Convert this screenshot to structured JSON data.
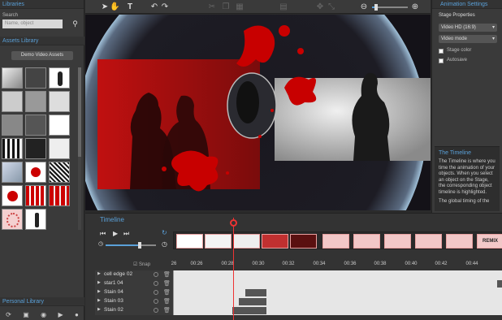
{
  "left_panel": {
    "libraries_title": "Libraries",
    "search_label": "Search",
    "search_placeholder": "Name, object",
    "asset_library_title": "Assets Library",
    "library_selected": "Demo Video Assets",
    "personal_library_title": "Personal Library"
  },
  "right_panel": {
    "title": "Animation Settings",
    "stage_properties": "Stage Properties",
    "video_format": "Video HD (16:9)",
    "video_mode": "Video mode",
    "stage_color_label": "Stage color",
    "autosave_label": "Autosave",
    "help_title": "The Timeline",
    "help_text_1": "The Timeline is where you time the animation of your objects. When you select an object on the Stage, the corresponding object timeline is highlighted.",
    "help_text_2": "The global timing of the"
  },
  "timeline": {
    "title": "Timeline",
    "snap_label": "Snap",
    "ticks": [
      "26",
      "00:26",
      "00:28",
      "00:30",
      "00:32",
      "00:34",
      "00:36",
      "00:38",
      "00:40",
      "00:42",
      "00:44"
    ],
    "frame_last_label": "REMIX",
    "rows": [
      {
        "name": "cell edge 02",
        "bar": null
      },
      {
        "name": "star1 04",
        "bar": null
      },
      {
        "name": "Stain 04",
        "bar": "a"
      },
      {
        "name": "Stain 03",
        "bar": "b"
      },
      {
        "name": "Stain 02",
        "bar": "c"
      }
    ]
  },
  "colors": {
    "accent": "#5aa0d8",
    "playhead": "#ee3333",
    "stain_red": "#c80000"
  }
}
